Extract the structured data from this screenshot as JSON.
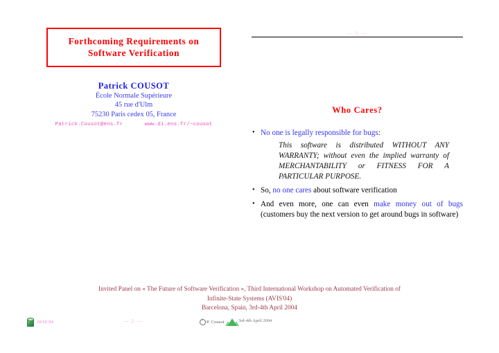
{
  "slide": {
    "title": {
      "line1": "Forthcoming Requirements on",
      "line2": "Software Verification"
    },
    "author": {
      "name": "Patrick COUSOT",
      "institution": "École Normale Supérieure",
      "street": "45 rue d'Ulm",
      "city": "75230 Paris cedex 05, France",
      "email": "Patrick.Cousot@ens.fr",
      "url": "www.di.ens.fr/~cousot"
    },
    "page_marker": "— 1 —",
    "section_title": "Who Cares?",
    "bullets": [
      {
        "prefix": "",
        "highlight": "No one is legally responsible for bugs",
        "suffix": ":",
        "quote": "This software is distributed WITHOUT ANY WARRANTY; without even the implied warranty of MERCHANTABILITY or FITNESS FOR A PARTICULAR PURPOSE."
      },
      {
        "prefix": "So, ",
        "highlight": "no one cares",
        "suffix": " about software verification",
        "quote": ""
      },
      {
        "prefix": "And even more, one can even ",
        "highlight": "make money out of bugs",
        "suffix": " (customers buy the next version to get around bugs in software)",
        "quote": ""
      }
    ],
    "venue": {
      "line1": "Invited Panel on « The Future of Software Verification », Third International Workshop on Automated Verification of",
      "line2": "Infinite-State Systems (AVIS'04)",
      "line3": "Barcelona, Spain, 3rd-4th April 2004"
    }
  },
  "statusbar": {
    "logo_label": "AVIS'04",
    "page_number": "— 2 —",
    "copyright": "P. Cousot",
    "date": "3rd-4th April 2004"
  },
  "colors": {
    "title_red": "#fe0000",
    "author_blue": "#1c1cf0",
    "contact_pink": "#f050b8",
    "highlight_blue": "#3333ee",
    "venue_maroon": "#9d3a4a",
    "status_pink": "#f9a8dd"
  }
}
